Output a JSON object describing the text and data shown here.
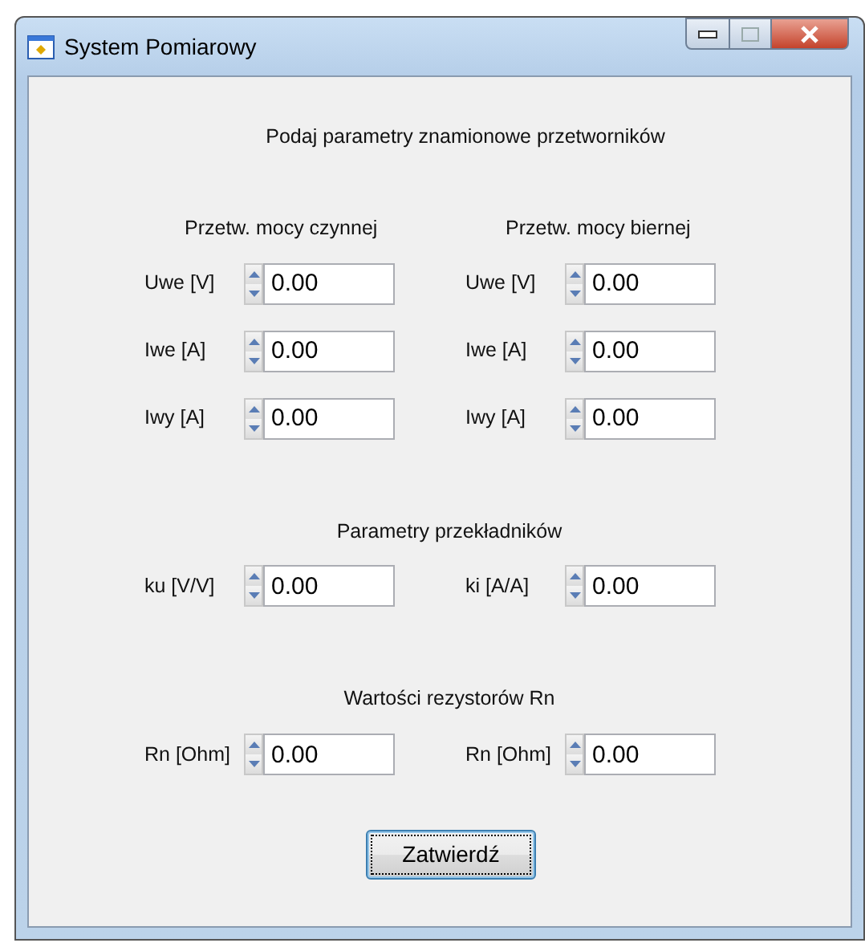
{
  "window": {
    "title": "System Pomiarowy"
  },
  "heading": "Podaj parametry znamionowe przetworników",
  "groups": [
    {
      "title": "Przetw. mocy czynnej",
      "fields": [
        {
          "label": "Uwe [V]",
          "value": "0.00"
        },
        {
          "label": "Iwe [A]",
          "value": "0.00"
        },
        {
          "label": "Iwy [A]",
          "value": "0.00"
        }
      ]
    },
    {
      "title": "Przetw. mocy biernej",
      "fields": [
        {
          "label": "Uwe [V]",
          "value": "0.00"
        },
        {
          "label": "Iwe [A]",
          "value": "0.00"
        },
        {
          "label": "Iwy [A]",
          "value": "0.00"
        }
      ]
    }
  ],
  "sections": [
    {
      "title": "Parametry przekładników",
      "fields": [
        {
          "label": "ku [V/V]",
          "value": "0.00"
        },
        {
          "label": "ki [A/A]",
          "value": "0.00"
        }
      ]
    },
    {
      "title": "Wartości rezystorów Rn",
      "fields": [
        {
          "label": "Rn [Ohm]",
          "value": "0.00"
        },
        {
          "label": "Rn [Ohm]",
          "value": "0.00"
        }
      ]
    }
  ],
  "button": {
    "label": "Zatwierdź",
    "focused": true
  }
}
